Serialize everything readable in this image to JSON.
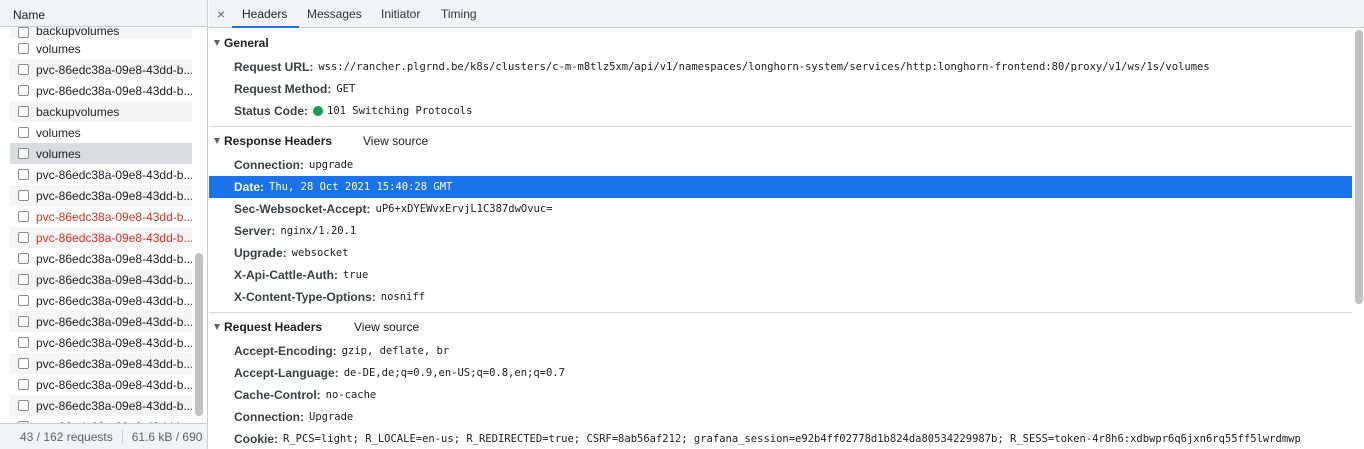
{
  "left_pane": {
    "column_header": "Name",
    "requests": [
      {
        "name": "backupvolumes",
        "state": "normal"
      },
      {
        "name": "volumes",
        "state": "normal"
      },
      {
        "name": "pvc-86edc38a-09e8-43dd-b...",
        "state": "normal"
      },
      {
        "name": "pvc-86edc38a-09e8-43dd-b...",
        "state": "normal"
      },
      {
        "name": "backupvolumes",
        "state": "normal"
      },
      {
        "name": "volumes",
        "state": "normal"
      },
      {
        "name": "volumes",
        "state": "selected"
      },
      {
        "name": "pvc-86edc38a-09e8-43dd-b...",
        "state": "normal"
      },
      {
        "name": "pvc-86edc38a-09e8-43dd-b...",
        "state": "normal"
      },
      {
        "name": "pvc-86edc38a-09e8-43dd-b...",
        "state": "error"
      },
      {
        "name": "pvc-86edc38a-09e8-43dd-b...",
        "state": "error"
      },
      {
        "name": "pvc-86edc38a-09e8-43dd-b...",
        "state": "normal"
      },
      {
        "name": "pvc-86edc38a-09e8-43dd-b...",
        "state": "normal"
      },
      {
        "name": "pvc-86edc38a-09e8-43dd-b...",
        "state": "normal"
      },
      {
        "name": "pvc-86edc38a-09e8-43dd-b...",
        "state": "normal"
      },
      {
        "name": "pvc-86edc38a-09e8-43dd-b...",
        "state": "normal"
      },
      {
        "name": "pvc-86edc38a-09e8-43dd-b...",
        "state": "normal"
      },
      {
        "name": "pvc-86edc38a-09e8-43dd-b...",
        "state": "normal"
      },
      {
        "name": "pvc-86edc38a-09e8-43dd-b...",
        "state": "normal"
      },
      {
        "name": "pvc-86edc38a-09e8-43dd-b...",
        "state": "normal"
      }
    ],
    "status": {
      "requests": "43 / 162 requests",
      "transferred": "61.6 kB / 690"
    }
  },
  "tabs": {
    "close_glyph": "×",
    "items": [
      "Headers",
      "Messages",
      "Initiator",
      "Timing"
    ],
    "active": "Headers"
  },
  "general": {
    "title": "General",
    "rows": [
      {
        "key": "Request URL:",
        "value": "wss://rancher.plgrnd.be/k8s/clusters/c-m-m8tlz5xm/api/v1/namespaces/longhorn-system/services/http:longhorn-frontend:80/proxy/v1/ws/1s/volumes"
      },
      {
        "key": "Request Method:",
        "value": "GET"
      },
      {
        "key": "Status Code:",
        "value": "101 Switching Protocols",
        "status_color": "#0f9d58"
      }
    ]
  },
  "response_headers": {
    "title": "Response Headers",
    "view_source": "View source",
    "rows": [
      {
        "key": "Connection:",
        "value": "upgrade"
      },
      {
        "key": "Date:",
        "value": "Thu, 28 Oct 2021 15:40:28 GMT",
        "selected": true
      },
      {
        "key": "Sec-Websocket-Accept:",
        "value": "uP6+xDYEWvxErvjL1C387dwOvuc="
      },
      {
        "key": "Server:",
        "value": "nginx/1.20.1"
      },
      {
        "key": "Upgrade:",
        "value": "websocket"
      },
      {
        "key": "X-Api-Cattle-Auth:",
        "value": "true"
      },
      {
        "key": "X-Content-Type-Options:",
        "value": "nosniff"
      }
    ]
  },
  "request_headers": {
    "title": "Request Headers",
    "view_source": "View source",
    "rows": [
      {
        "key": "Accept-Encoding:",
        "value": "gzip, deflate, br"
      },
      {
        "key": "Accept-Language:",
        "value": "de-DE,de;q=0.9,en-US;q=0.8,en;q=0.7"
      },
      {
        "key": "Cache-Control:",
        "value": "no-cache"
      },
      {
        "key": "Connection:",
        "value": "Upgrade"
      },
      {
        "key": "Cookie:",
        "value": "R_PCS=light; R_LOCALE=en-us; R_REDIRECTED=true; CSRF=8ab56af212; grafana_session=e92b4ff02778d1b824da80534229987b; R_SESS=token-4r8h6:xdbwpr6q6jxn6rq55ff5lwrdmwp"
      }
    ]
  },
  "colors": {
    "accent": "#1a73e8",
    "error": "#d93025",
    "toolbar_bg": "#f1f3f4"
  }
}
